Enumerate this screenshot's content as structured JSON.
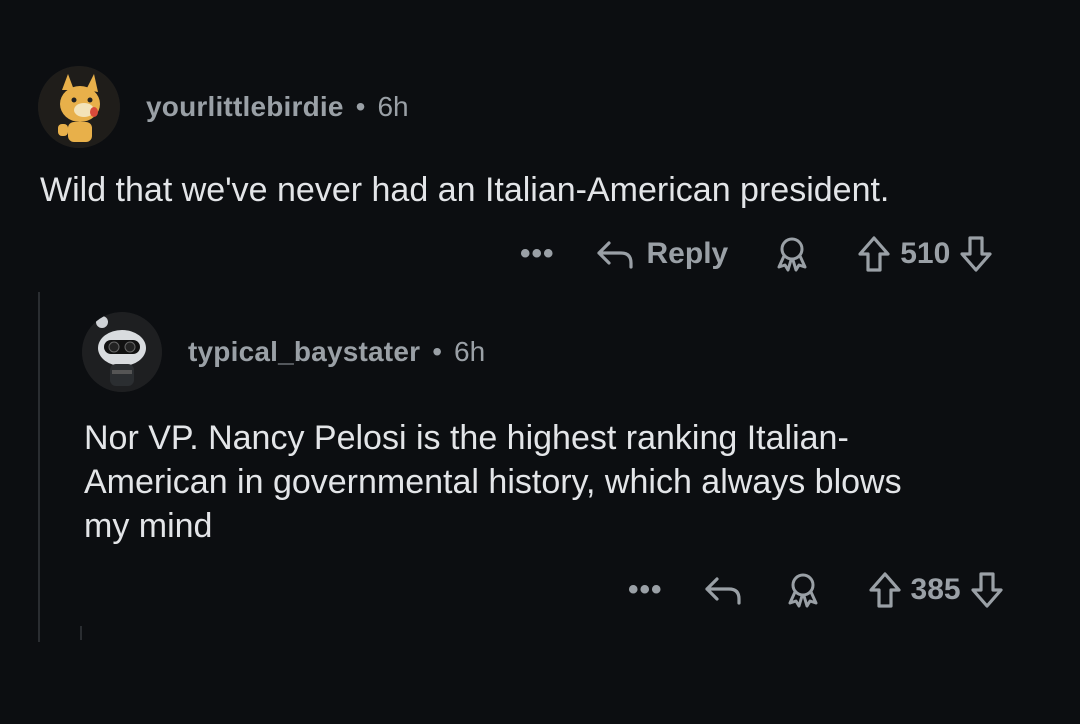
{
  "comments": [
    {
      "username": "yourlittlebirdie",
      "separator": "•",
      "time": "6h",
      "body": "Wild that we've never had an Italian-American president.",
      "actions": {
        "more": "•••",
        "reply_label": "Reply",
        "score": "510"
      },
      "avatar_icon": "dog-snoo-avatar"
    },
    {
      "username": "typical_baystater",
      "separator": "•",
      "time": "6h",
      "body": "Nor VP. Nancy Pelosi is the highest ranking Italian-\nAmerican in governmental history, which always blows\nmy mind",
      "actions": {
        "more": "•••",
        "score": "385"
      },
      "avatar_icon": "astronaut-snoo-avatar"
    }
  ],
  "colors": {
    "background": "#0c0e11",
    "meta": "#9aa0a6",
    "text": "#e3e5e8"
  }
}
